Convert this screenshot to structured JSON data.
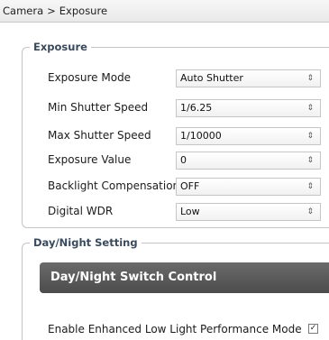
{
  "breadcrumb": {
    "parent": "Camera",
    "separator": ">",
    "current": "Exposure"
  },
  "exposure": {
    "legend": "Exposure",
    "rows": [
      {
        "label": "Exposure Mode",
        "value": "Auto Shutter"
      },
      {
        "label": "Min Shutter Speed",
        "value": "1/6.25"
      },
      {
        "label": "Max Shutter Speed",
        "value": "1/10000"
      },
      {
        "label": "Exposure Value",
        "value": "0"
      },
      {
        "label": "Backlight Compensation",
        "value": "OFF"
      },
      {
        "label": "Digital WDR",
        "value": "Low"
      }
    ],
    "select_arrow": "⇕"
  },
  "daynight": {
    "legend": "Day/Night Setting",
    "switch_header": "Day/Night Switch Control",
    "enhanced_low_light_label": "Enable Enhanced Low Light Performance Mode",
    "enhanced_low_light_checked": true,
    "check_mark": "✓"
  },
  "colors": {
    "header_bg": "#555555",
    "legend_text": "#3a4a5c",
    "border": "#c4c4c4"
  }
}
